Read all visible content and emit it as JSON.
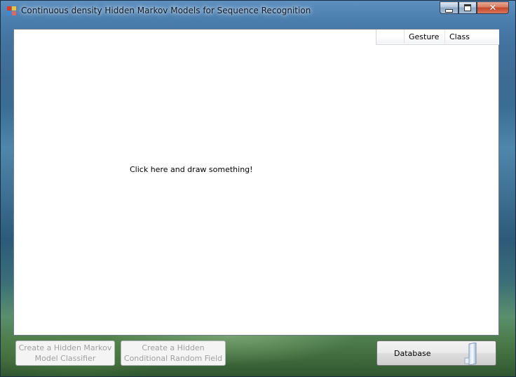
{
  "window": {
    "title": "Continuous density Hidden Markov Models for Sequence Recognition",
    "controls": {
      "minimize": "minimize",
      "maximize": "maximize",
      "close": "close"
    }
  },
  "canvas": {
    "instruction": "Click here and draw something!"
  },
  "grid": {
    "columns": [
      "",
      "Gesture",
      "Class"
    ]
  },
  "buttons": {
    "hmm_line1": "Create a Hidden Markov",
    "hmm_line2": "Model Classifier",
    "hcrf_line1": "Create a Hidden",
    "hcrf_line2": "Conditional Random Field",
    "database": "Database"
  },
  "colors": {
    "canvas_bg": "#ffffff",
    "disabled_text": "#a0a0a0",
    "close_button": "#c4462a"
  },
  "icons": {
    "app": "app-icon",
    "database": "database-panel-icon"
  }
}
